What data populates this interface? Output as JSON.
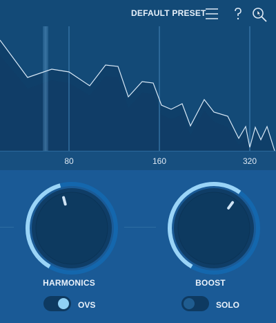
{
  "header": {
    "preset_label": "DEFAULT PRESET",
    "icons": [
      "menu-icon",
      "help-icon",
      "zoom-icon"
    ]
  },
  "spectrum": {
    "frequency_labels": [
      "80",
      "160",
      "320"
    ]
  },
  "controls": {
    "harmonics": {
      "label": "HARMONICS",
      "value": 0.45
    },
    "boost": {
      "label": "BOOST",
      "value": 0.62
    }
  },
  "toggles": {
    "ovs": {
      "label": "OVS",
      "on": true
    },
    "solo": {
      "label": "SOLO",
      "on": false
    }
  },
  "colors": {
    "accent": "#8fd0f5",
    "arc_active": "#9ad4f7",
    "arc_track": "#1467ad",
    "panel_bg": "#1a5a96",
    "spectrum_bg": "#134a77"
  }
}
